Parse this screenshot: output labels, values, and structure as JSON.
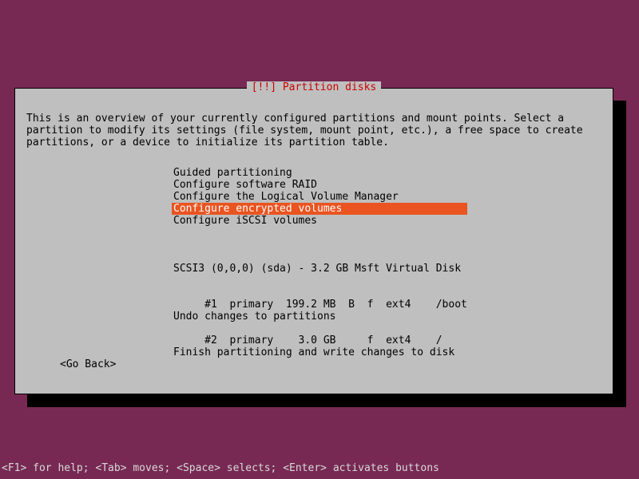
{
  "title": "[!!] Partition disks",
  "intro": "This is an overview of your currently configured partitions and mount points. Select a partition to modify its settings (file system, mount point, etc.), a free space to create partitions, or a device to initialize its partition table.",
  "menu": {
    "items": [
      "Guided partitioning",
      "Configure software RAID",
      "Configure the Logical Volume Manager",
      "Configure encrypted volumes",
      "Configure iSCSI volumes"
    ],
    "selected_index": 3
  },
  "disk": {
    "header": "SCSI3 (0,0,0) (sda) - 3.2 GB Msft Virtual Disk",
    "rows": [
      "     #1  primary  199.2 MB  B  f  ext4    /boot",
      "     #2  primary    3.0 GB     f  ext4    /"
    ]
  },
  "actions": {
    "undo": "Undo changes to partitions",
    "finish": "Finish partitioning and write changes to disk"
  },
  "goback": "<Go Back>",
  "helpbar": "<F1> for help; <Tab> moves; <Space> selects; <Enter> activates buttons"
}
